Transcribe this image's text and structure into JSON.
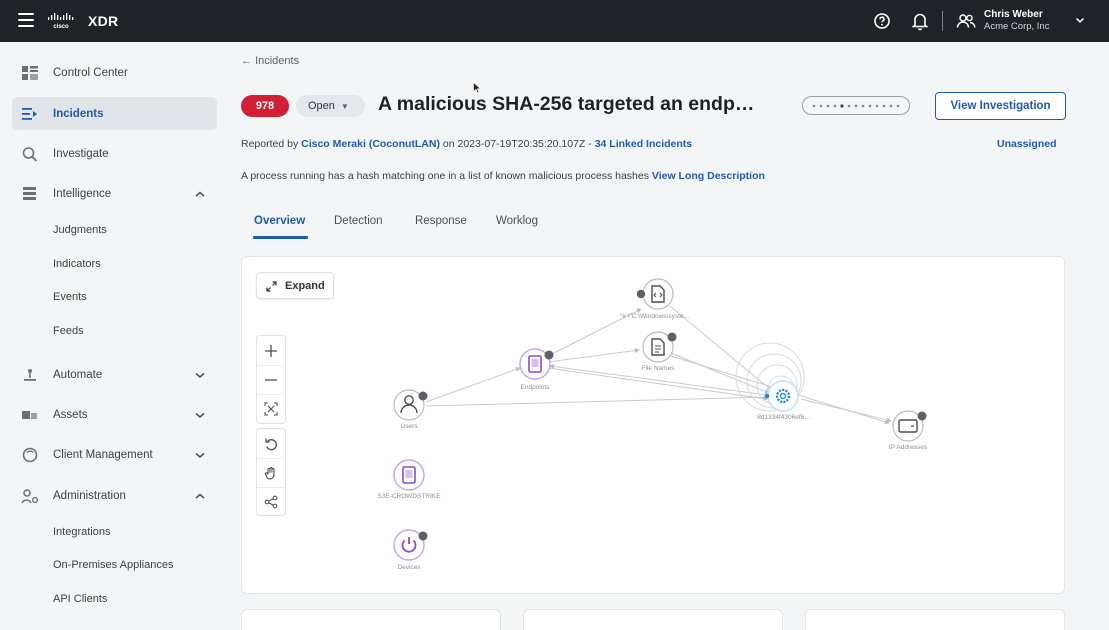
{
  "topbar": {
    "app_name": "XDR",
    "user_name": "Chris Weber",
    "user_org": "Acme Corp, Inc"
  },
  "sidebar": {
    "items": [
      {
        "label": "Control Center",
        "icon": "dashboard-icon"
      },
      {
        "label": "Incidents",
        "icon": "incidents-icon",
        "active": true
      },
      {
        "label": "Investigate",
        "icon": "search-icon"
      },
      {
        "label": "Intelligence",
        "icon": "intelligence-icon",
        "expanded": true
      },
      {
        "label": "Automate",
        "icon": "automate-icon",
        "expanded": false
      },
      {
        "label": "Assets",
        "icon": "assets-icon",
        "expanded": false
      },
      {
        "label": "Client Management",
        "icon": "client-management-icon",
        "expanded": false
      },
      {
        "label": "Administration",
        "icon": "administration-icon",
        "expanded": true
      }
    ],
    "intelligence_sub": [
      "Judgments",
      "Indicators",
      "Events",
      "Feeds"
    ],
    "administration_sub": [
      "Integrations",
      "On-Premises Appliances",
      "API Clients"
    ]
  },
  "incident": {
    "back_label": "Incidents",
    "number": "978",
    "status": "Open",
    "title": "A malicious SHA-256 targeted an endp…",
    "view_investigation": "View Investigation",
    "reported_by_prefix": "Reported by",
    "reporter": "Cisco Meraki (CoconutLAN)",
    "on_word": "on",
    "timestamp": "2023-07-19T20:35:20.107Z",
    "separator": "-",
    "linked": "34 Linked Incidents",
    "assignee": "Unassigned",
    "description": "A process running has a hash matching one in a list of known malicious process hashes",
    "view_long_description": "View Long Description"
  },
  "tabs": [
    "Overview",
    "Detection",
    "Response",
    "Worklog"
  ],
  "graph": {
    "expand_label": "Expand",
    "node_labels": {
      "users": "Users",
      "endpoints": "Endpoints",
      "process_path": "\"# \\\"C:\\Windows\\syste…",
      "file_names": "File Names",
      "sha": "8d1334f4306ef6…",
      "ip_addresses": "IP Addresses",
      "crowdstrike": "S3E-CROWDSTRIKE",
      "devices": "Devices"
    }
  },
  "colors": {
    "accent": "#1f5bb5",
    "badge_red": "#d21f34",
    "node_purple": "#8a4bd1",
    "node_blue": "#1c8bd6"
  }
}
